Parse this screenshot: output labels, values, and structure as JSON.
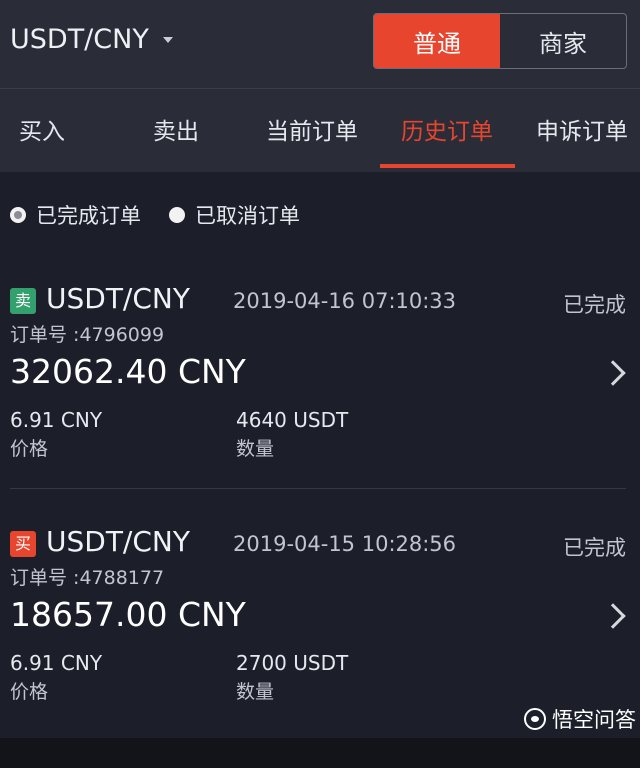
{
  "header": {
    "pair": "USDT/CNY",
    "modes": [
      {
        "label": "普通",
        "active": true
      },
      {
        "label": "商家",
        "active": false
      }
    ]
  },
  "tabs": [
    {
      "label": "买入"
    },
    {
      "label": "卖出"
    },
    {
      "label": "当前订单"
    },
    {
      "label": "历史订单",
      "active": true
    },
    {
      "label": "申诉订单"
    }
  ],
  "filters": [
    {
      "label": "已完成订单",
      "checked": true
    },
    {
      "label": "已取消订单",
      "checked": false
    }
  ],
  "orders": [
    {
      "side_label": "卖",
      "side": "sell",
      "pair": "USDT/CNY",
      "time": "2019-04-16 07:10:33",
      "status": "已完成",
      "order_no": "订单号 :4796099",
      "total": "32062.40 CNY",
      "price": "6.91 CNY",
      "price_label": "价格",
      "qty": "4640 USDT",
      "qty_label": "数量"
    },
    {
      "side_label": "买",
      "side": "buy",
      "pair": "USDT/CNY",
      "time": "2019-04-15 10:28:56",
      "status": "已完成",
      "order_no": "订单号 :4788177",
      "total": "18657.00 CNY",
      "price": "6.91 CNY",
      "price_label": "价格",
      "qty": "2700 USDT",
      "qty_label": "数量"
    }
  ],
  "watermark": "悟空问答",
  "colors": {
    "accent": "#e8452f",
    "sell": "#33a16e",
    "background": "#1c1f2a",
    "header": "#2a2d38"
  }
}
